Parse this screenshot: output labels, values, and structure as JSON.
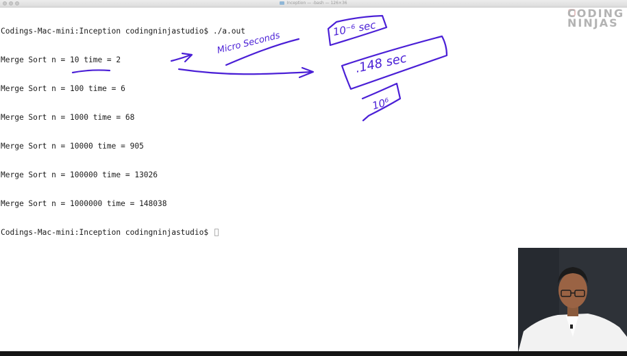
{
  "window": {
    "title": "Inception — -bash — 126×36"
  },
  "terminal": {
    "lines": [
      "Codings-Mac-mini:Inception codingninjastudio$ ./a.out",
      "Merge Sort n = 10 time = 2",
      "Merge Sort n = 100 time = 6",
      "Merge Sort n = 1000 time = 68",
      "Merge Sort n = 10000 time = 905",
      "Merge Sort n = 100000 time = 13026",
      "Merge Sort n = 1000000 time = 148038",
      "Codings-Mac-mini:Inception codingninjastudio$ "
    ]
  },
  "logo": {
    "line1": "CODING",
    "line2": "NINJAS"
  },
  "annotations": {
    "ink_color": "#4a1fd6",
    "micro_seconds": "Micro Seconds",
    "ten_neg6_sec": "10⁻⁶ sec",
    "point_148_sec": ".148 sec",
    "ten_6": "10⁶"
  },
  "colors": {
    "terminal_bg": "#ffffff",
    "terminal_text": "#1a1a1a"
  }
}
